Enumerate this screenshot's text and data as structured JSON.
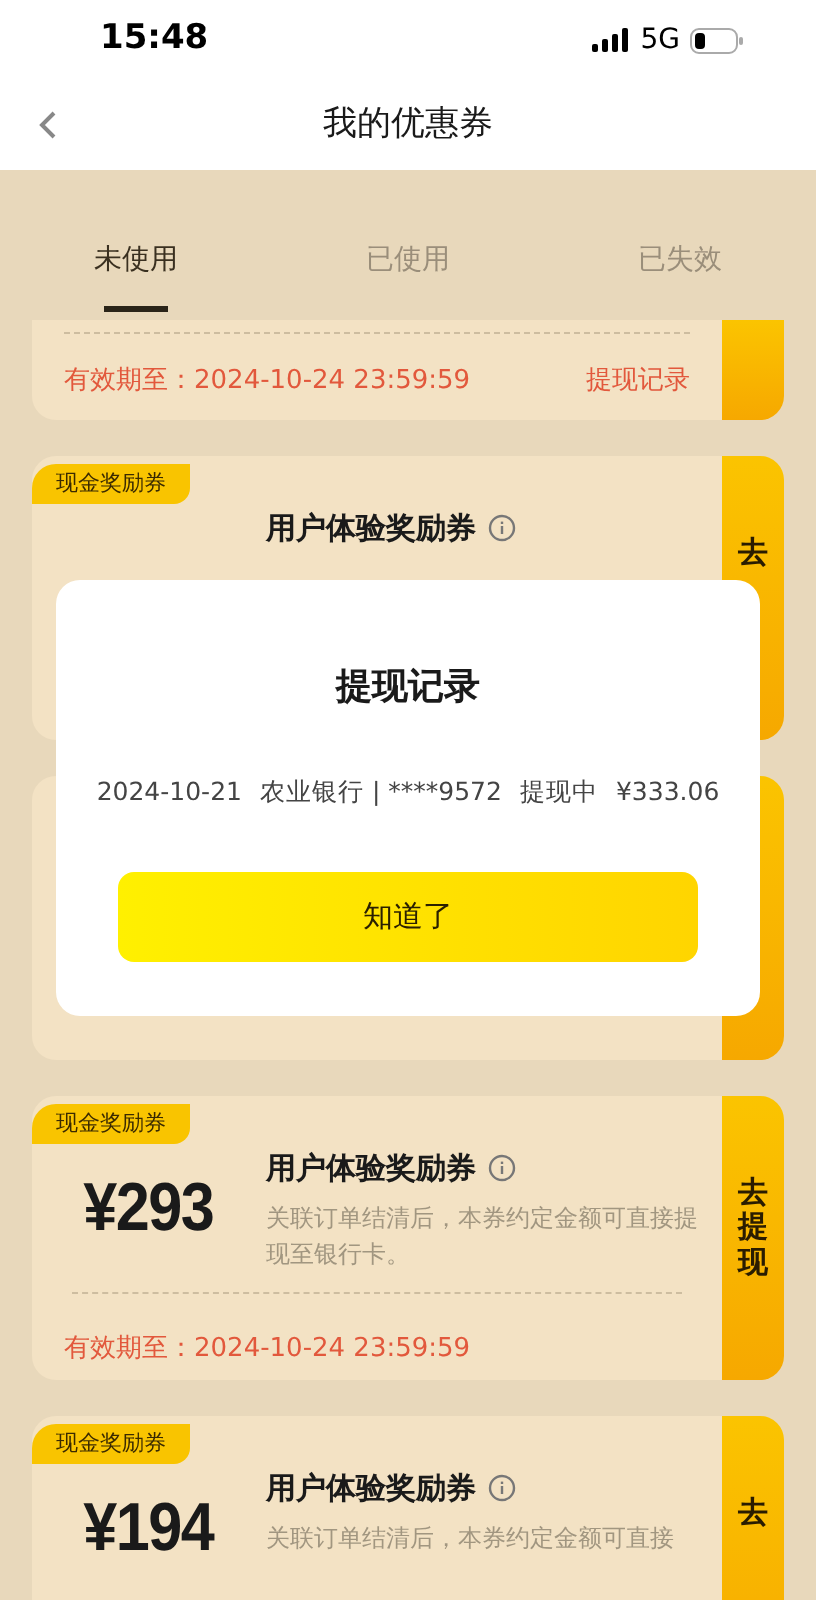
{
  "status_bar": {
    "time": "15:48",
    "network": "5G"
  },
  "nav": {
    "title": "我的优惠券"
  },
  "tabs": [
    {
      "label": "未使用",
      "selected": true
    },
    {
      "label": "已使用",
      "selected": false
    },
    {
      "label": "已失效",
      "selected": false
    }
  ],
  "coupons": [
    {
      "kind": "tail",
      "expiry": "有效期至：2024-10-24 23:59:59",
      "link": "提现记录"
    },
    {
      "kind": "full",
      "tag": "现金奖励券",
      "title": "用户体验奖励券",
      "action": "去"
    },
    {
      "kind": "full"
    },
    {
      "kind": "full",
      "tag": "现金奖励券",
      "amount": "¥293",
      "title": "用户体验奖励券",
      "description": "关联订单结清后，本券约定金额可直接提现至银行卡。",
      "expiry": "有效期至：2024-10-24 23:59:59",
      "action": "去提现"
    },
    {
      "kind": "full",
      "tag": "现金奖励券",
      "amount": "¥194",
      "title": "用户体验奖励券",
      "description": "关联订单结清后，本券约定金额可直接",
      "action": "去"
    }
  ],
  "dialog": {
    "title": "提现记录",
    "record": {
      "date": "2024-10-21",
      "bank": "农业银行 | ****9572",
      "status": "提现中",
      "amount": "¥333.06"
    },
    "button": "知道了"
  }
}
